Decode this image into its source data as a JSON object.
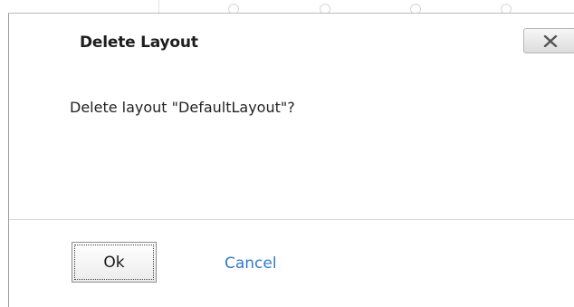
{
  "dialog": {
    "title": "Delete Layout",
    "close_icon": "close-x-icon",
    "message": "Delete layout \"DefaultLayout\"?",
    "ok_label": "Ok",
    "cancel_label": "Cancel"
  },
  "colors": {
    "link": "#2f7bd0",
    "title_text": "#1e1e1e",
    "divider": "#d4d4d4"
  }
}
